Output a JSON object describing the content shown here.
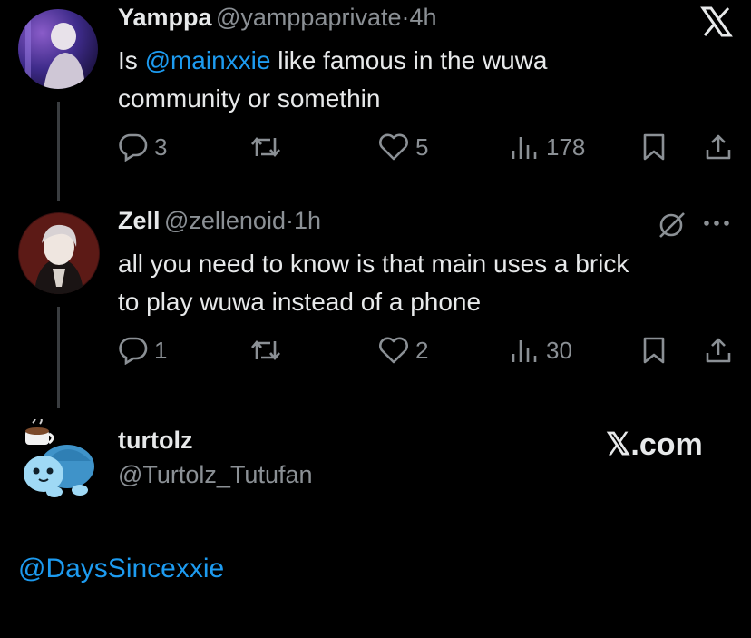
{
  "tweet1": {
    "name": "Yamppa",
    "handle": "@yamppaprivate",
    "dot": "·",
    "time": "4h",
    "text_prefix": "Is ",
    "mention": "@mainxxie",
    "text_line1_rest": " like famous in the wuwa",
    "text_line2": "community or somethin",
    "replies": "3",
    "likes": "5",
    "views": "178",
    "platform_icon": "x-logo-icon"
  },
  "tweet2": {
    "name": "Zell",
    "handle": "@zellenoid",
    "dot": "·",
    "time": "1h",
    "text_line1": "all you need to know is that main uses a brick",
    "text_line2": "to play wuwa instead of a phone",
    "replies": "1",
    "likes": "2",
    "views": "30"
  },
  "tweet3": {
    "name": "turtolz",
    "handle": "@Turtolz_Tutufan",
    "brand": "𝕏.com",
    "mention": "@DaysSincexxie"
  },
  "colors": {
    "background": "#000000",
    "text": "#e7e9ea",
    "muted": "#8b9095",
    "link": "#1d9bf0"
  }
}
